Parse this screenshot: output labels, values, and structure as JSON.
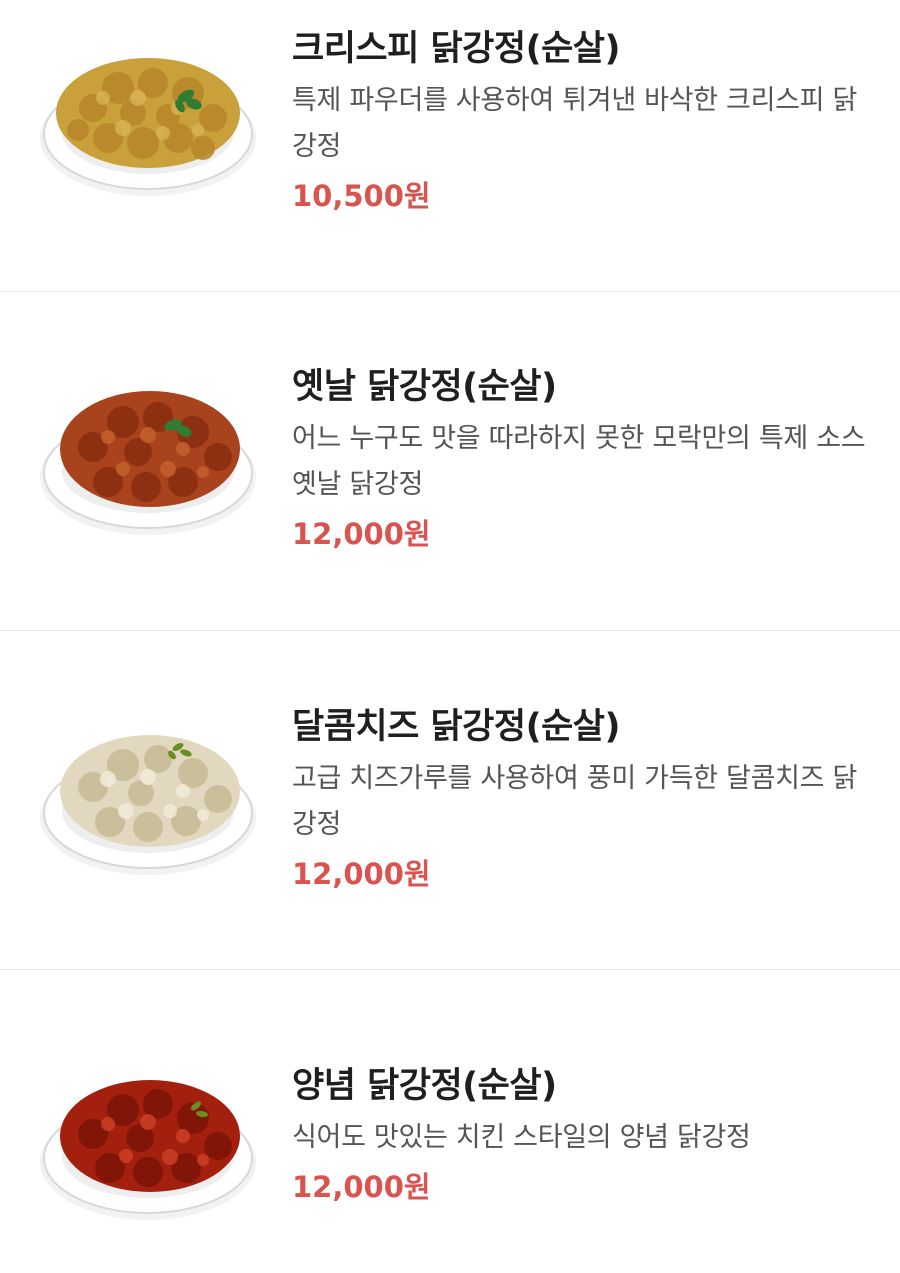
{
  "menu": {
    "items": [
      {
        "name": "크리스피 닭강정(순살)",
        "description": "특제 파우더를 사용하여 튀겨낸 바삭한 크리스피 닭강정",
        "price": "10,500원",
        "image_icon": "crispy-chicken-plate-icon",
        "food_color": "#c9a03a"
      },
      {
        "name": "옛날 닭강정(순살)",
        "description": "어느 누구도 맛을 따라하지 못한 모락만의 특제 소스 옛날 닭강정",
        "price": "12,000원",
        "image_icon": "classic-chicken-plate-icon",
        "food_color": "#a8431d"
      },
      {
        "name": "달콤치즈 닭강정(순살)",
        "description": "고급 치즈가루를 사용하여 풍미 가득한 달콤치즈 닭강정",
        "price": "12,000원",
        "image_icon": "cheese-chicken-plate-icon",
        "food_color": "#e2d8bf"
      },
      {
        "name": "양념 닭강정(순살)",
        "description": "식어도 맛있는 치킨 스타일의 양념 닭강정",
        "price": "12,000원",
        "image_icon": "spicy-chicken-plate-icon",
        "food_color": "#a3200f"
      }
    ]
  },
  "colors": {
    "price": "#d9534f",
    "name": "#1f1f1f",
    "description": "#555555",
    "divider": "#e6e6e6"
  }
}
